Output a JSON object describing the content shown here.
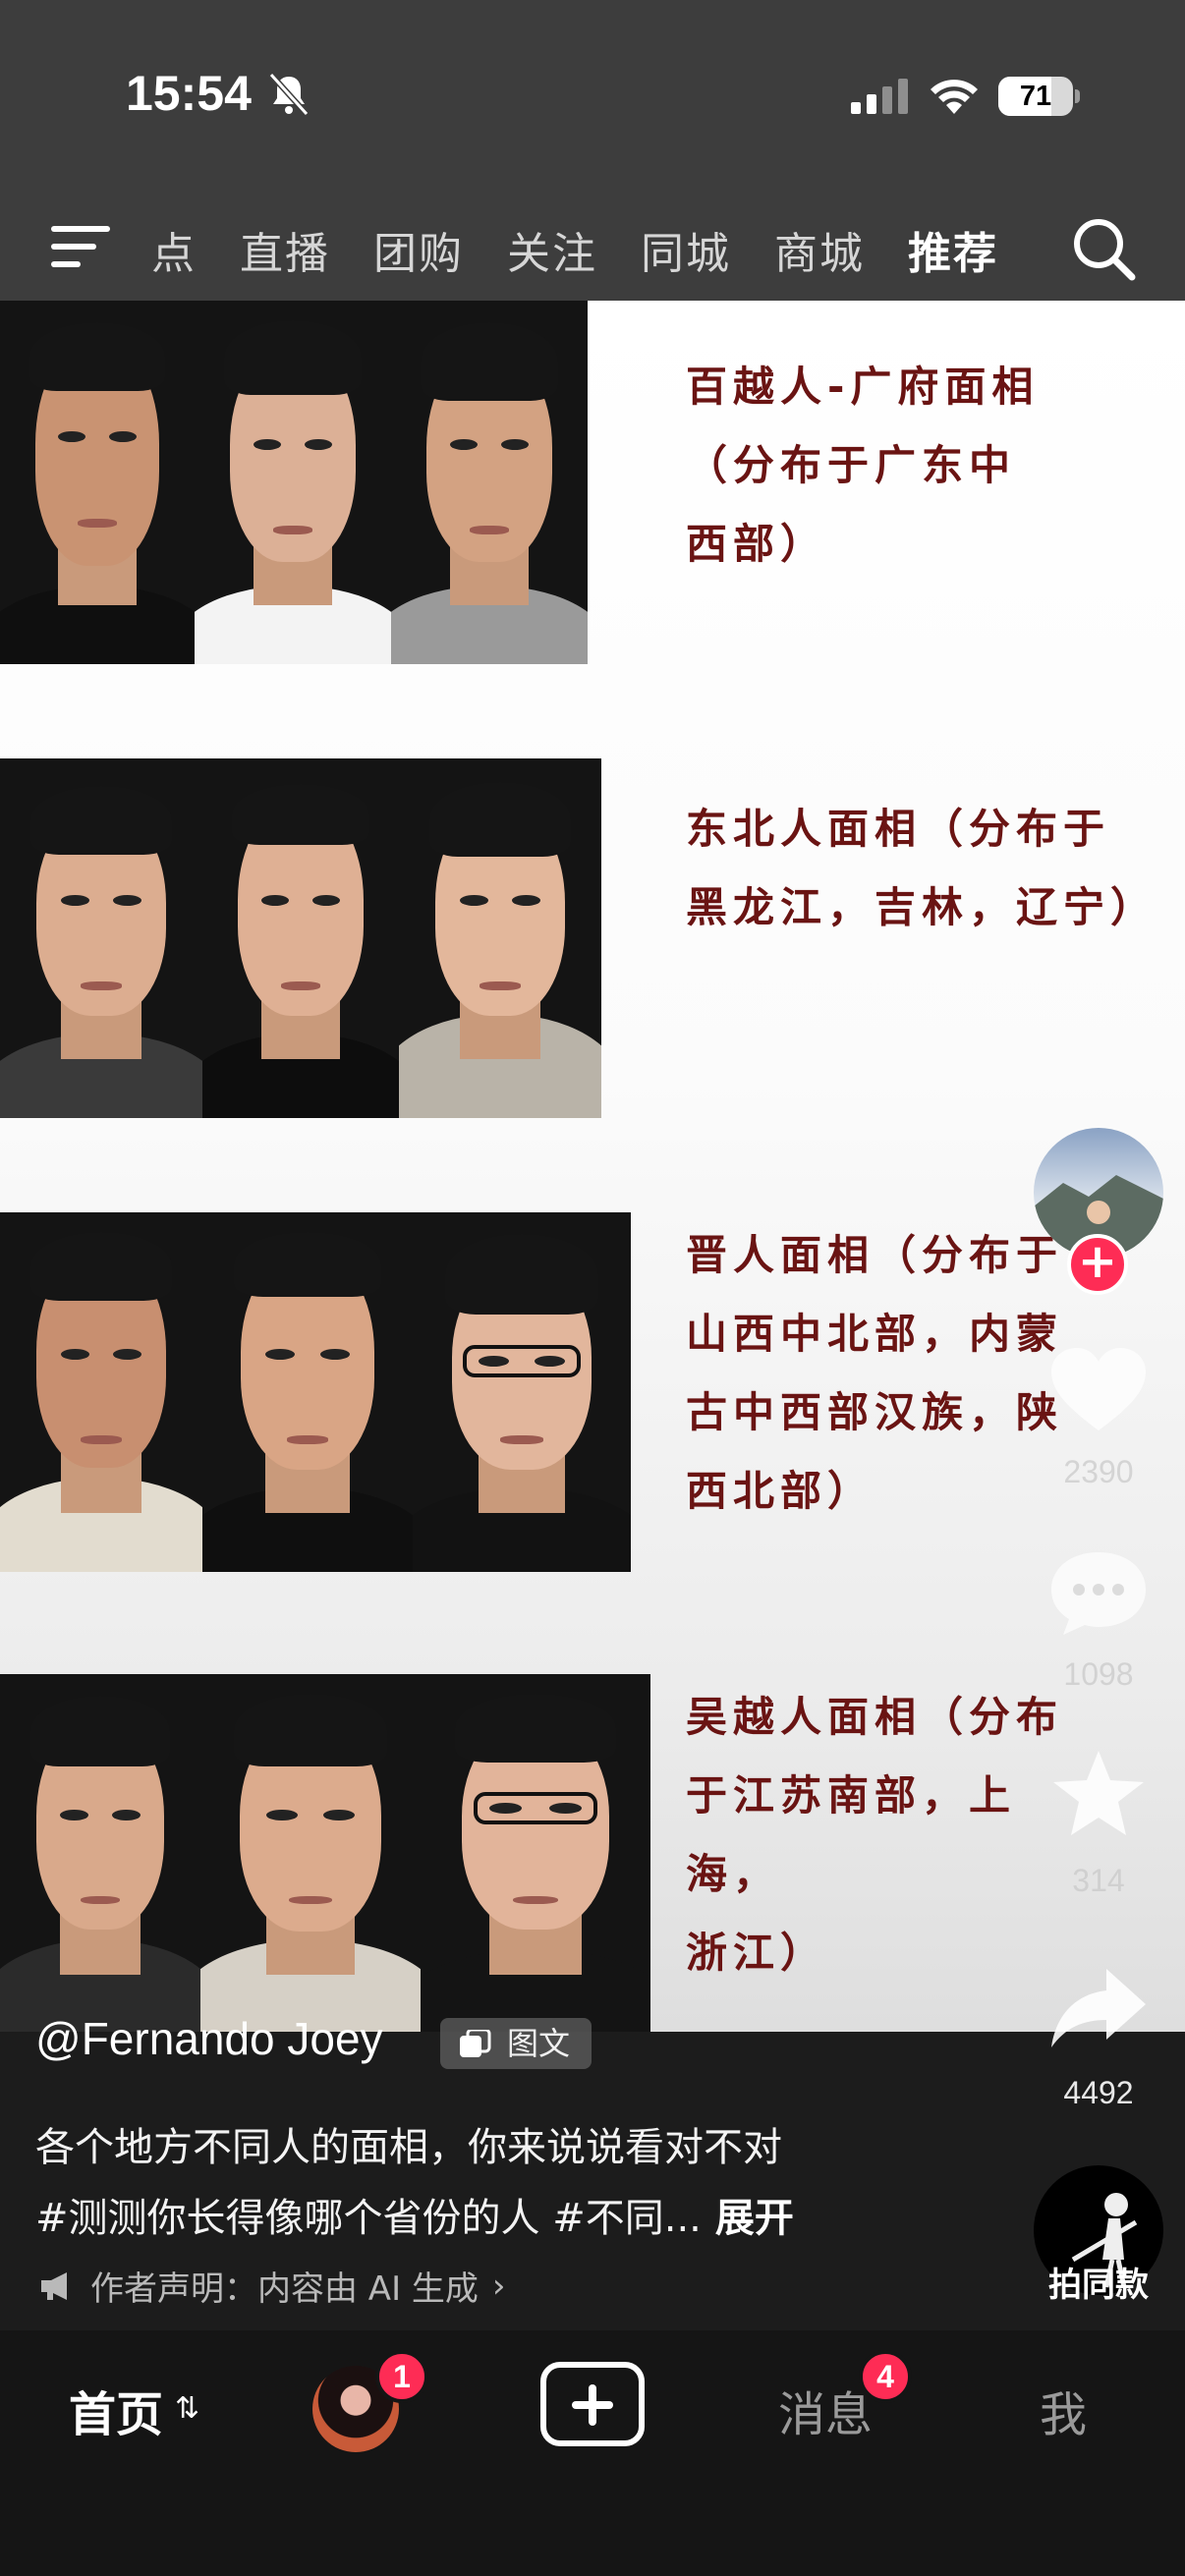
{
  "status_bar": {
    "time": "15:54",
    "battery": "71",
    "battery_level": 0.71
  },
  "top_tabs": [
    "点",
    "直播",
    "团购",
    "关注",
    "同城",
    "商城",
    "推荐"
  ],
  "active_tab": "推荐",
  "rows": [
    {
      "caption_lines": [
        "百越人-广府面相",
        "（分布于广东中",
        "西部）"
      ]
    },
    {
      "caption_lines": [
        "东北人面相（分布于",
        "黑龙江，吉林，辽宁）"
      ]
    },
    {
      "caption_lines": [
        "晋人面相（分布于",
        "山西中北部，内蒙",
        "古中西部汉族，陕",
        "西北部）"
      ]
    },
    {
      "caption_lines": [
        "吴越人面相（分布",
        "于江苏南部，上海，",
        "浙江）"
      ]
    }
  ],
  "rail": {
    "likes": "2390",
    "comments": "1098",
    "favorites": "314",
    "shares": "4492",
    "same_label": "拍同款"
  },
  "author": "@Fernando Joey",
  "post_type": "图文",
  "description_line1": "各个地方不同人的面相，你来说说看对不对",
  "description_line2": "#测测你长得像哪个省份的人 #不同...",
  "expand_label": "展开",
  "statement": "作者声明：内容由 AI 生成",
  "bottom_nav": {
    "home": "首页",
    "friends_badge": "1",
    "messages": "消息",
    "messages_badge": "4",
    "me": "我"
  }
}
